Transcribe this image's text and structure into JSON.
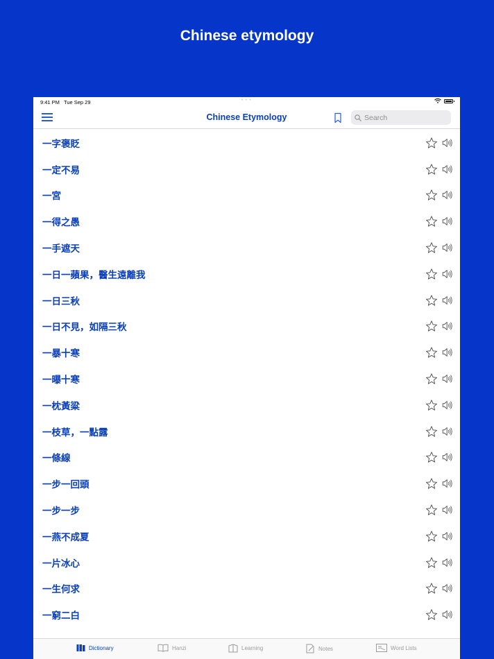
{
  "hero": {
    "title": "Chinese etymology"
  },
  "status_bar": {
    "time": "9:41 PM",
    "date": "Tue Sep 29"
  },
  "nav": {
    "title": "Chinese Etymology",
    "search_placeholder": "Search",
    "search_value": ""
  },
  "list": {
    "items": [
      {
        "label": "一字褒貶"
      },
      {
        "label": "一定不易"
      },
      {
        "label": "一宮"
      },
      {
        "label": "一得之愚"
      },
      {
        "label": "一手遮天"
      },
      {
        "label": "一日一蘋果，醫生遠離我"
      },
      {
        "label": "一日三秋"
      },
      {
        "label": "一日不見，如隔三秋"
      },
      {
        "label": "一暴十寒"
      },
      {
        "label": "一曝十寒"
      },
      {
        "label": "一枕黃粱"
      },
      {
        "label": "一枝草，一點露"
      },
      {
        "label": "一條線"
      },
      {
        "label": "一步一回頭"
      },
      {
        "label": "一步一步"
      },
      {
        "label": "一燕不成夏"
      },
      {
        "label": "一片冰心"
      },
      {
        "label": "一生何求"
      },
      {
        "label": "一窮二白"
      }
    ]
  },
  "tabs": [
    {
      "label": "Dictionary",
      "icon": "dictionary-icon",
      "active": true
    },
    {
      "label": "Hanzi",
      "icon": "book-icon",
      "active": false
    },
    {
      "label": "Learning",
      "icon": "learning-icon",
      "active": false
    },
    {
      "label": "Notes",
      "icon": "notes-icon",
      "active": false
    },
    {
      "label": "Word Lists",
      "icon": "word-lists-icon",
      "active": false
    }
  ],
  "colors": {
    "background": "#0636c9",
    "accent": "#0a3fb8",
    "inactive": "#9a9a9a"
  }
}
